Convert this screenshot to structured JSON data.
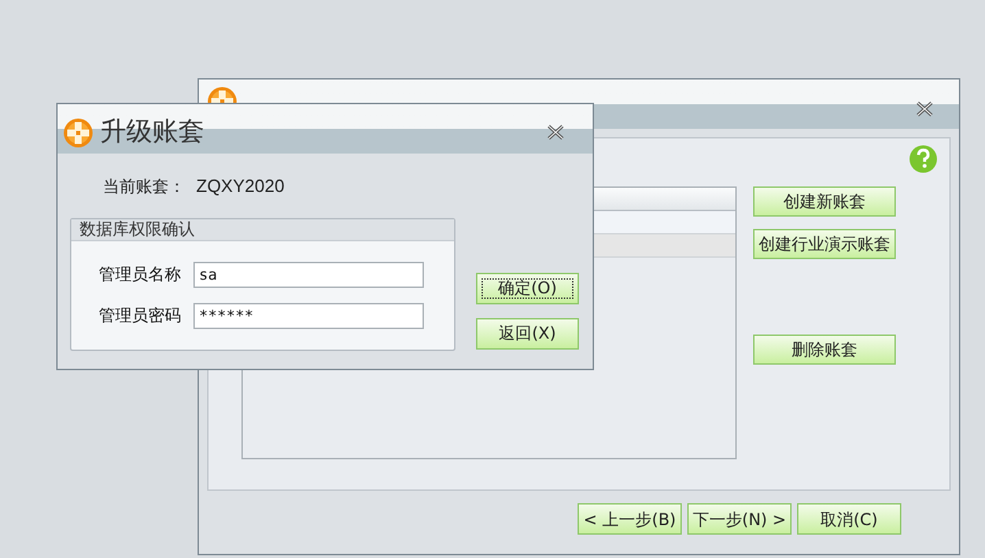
{
  "back_window": {
    "list_rows": [
      {
        "selected": false
      },
      {
        "selected": true
      }
    ],
    "side_buttons": [
      {
        "label": "创建新账套",
        "kind": "top"
      },
      {
        "label": "创建行业演示账套",
        "kind": "top"
      },
      {
        "label": "删除账套",
        "kind": "bottom"
      }
    ],
    "nav_buttons": [
      {
        "label": "< 上一步(B)"
      },
      {
        "label": "下一步(N) >"
      },
      {
        "label": "取消(C)"
      }
    ]
  },
  "dialog": {
    "title": "升级账套",
    "current_label": "当前账套：",
    "current_value": "ZQXY2020",
    "group_title": "数据库权限确认",
    "fields": [
      {
        "label": "管理员名称",
        "value": "sa"
      },
      {
        "label": "管理员密码",
        "value": "******"
      }
    ],
    "buttons": [
      {
        "label": "确定(O)",
        "focused": true
      },
      {
        "label": "返回(X)",
        "focused": false
      }
    ]
  }
}
